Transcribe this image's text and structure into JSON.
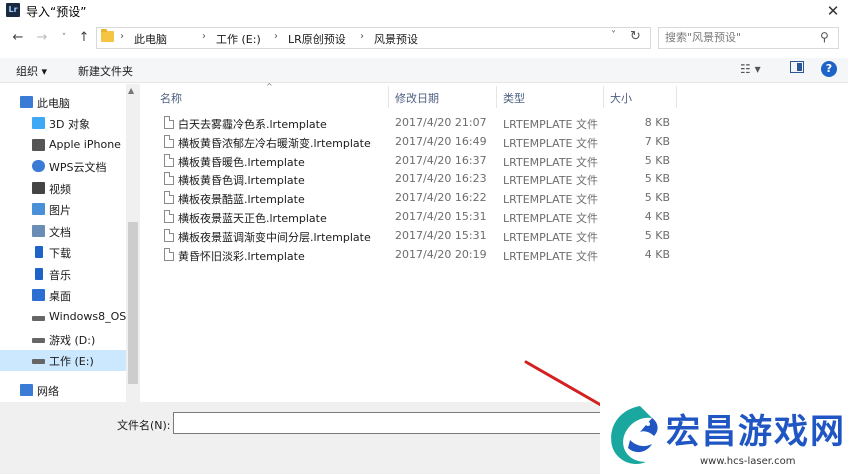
{
  "window": {
    "app_icon_text": "Lr",
    "title": "导入“预设”",
    "close_glyph": "✕"
  },
  "nav": {
    "back_glyph": "←",
    "forward_glyph": "→",
    "recent_glyph": "˅",
    "up_glyph": "↑",
    "breadcrumbs": [
      "此电脑",
      "工作 (E:)",
      "LR原创预设",
      "风景预设"
    ],
    "breadcrumb_sep": "›",
    "dropdown_glyph": "˅",
    "refresh_glyph": "↻",
    "search_placeholder": "搜索\"风景预设\"",
    "search_icon_glyph": "⚲"
  },
  "toolbar": {
    "organize": "组织 ▾",
    "new_folder": "新建文件夹",
    "view_glyph": "☷ ▾",
    "help_glyph": "?"
  },
  "sidebar": {
    "items": [
      {
        "label": "此电脑",
        "icon": "computer-icon",
        "color": "#3a7bd5"
      },
      {
        "label": "3D 对象",
        "icon": "cube-icon",
        "color": "#3fa9f5"
      },
      {
        "label": "Apple iPhone",
        "icon": "phone-icon",
        "color": "#555555"
      },
      {
        "label": "WPS云文档",
        "icon": "cloud-icon",
        "color": "#3a7bd5"
      },
      {
        "label": "视频",
        "icon": "film-icon",
        "color": "#444444"
      },
      {
        "label": "图片",
        "icon": "image-icon",
        "color": "#4a90d9"
      },
      {
        "label": "文档",
        "icon": "document-icon",
        "color": "#6a8db5"
      },
      {
        "label": "下载",
        "icon": "download-icon",
        "color": "#1e64c8"
      },
      {
        "label": "音乐",
        "icon": "music-icon",
        "color": "#1e64c8"
      },
      {
        "label": "桌面",
        "icon": "desktop-icon",
        "color": "#2a6fd1"
      },
      {
        "label": "Windows8_OS",
        "icon": "drive-icon",
        "color": "#666666"
      },
      {
        "label": "游戏 (D:)",
        "icon": "drive-icon",
        "color": "#666666"
      },
      {
        "label": "工作 (E:)",
        "icon": "drive-icon",
        "color": "#666666",
        "selected": true
      },
      {
        "label": "网络",
        "icon": "network-icon",
        "color": "#3a7bd5"
      }
    ]
  },
  "columns": {
    "name": "名称",
    "date": "修改日期",
    "type": "类型",
    "size": "大小",
    "sort_glyph": "^"
  },
  "files": [
    {
      "name": "白天去雾霾冷色系.lrtemplate",
      "date": "2017/4/20 21:07",
      "type": "LRTEMPLATE 文件",
      "size": "8 KB"
    },
    {
      "name": "横板黄昏浓郁左冷右暖渐变.lrtemplate",
      "date": "2017/4/20 16:49",
      "type": "LRTEMPLATE 文件",
      "size": "7 KB"
    },
    {
      "name": "横板黄昏暖色.lrtemplate",
      "date": "2017/4/20 16:37",
      "type": "LRTEMPLATE 文件",
      "size": "5 KB"
    },
    {
      "name": "横板黄昏色调.lrtemplate",
      "date": "2017/4/20 16:23",
      "type": "LRTEMPLATE 文件",
      "size": "5 KB"
    },
    {
      "name": "横板夜景酷蓝.lrtemplate",
      "date": "2017/4/20 16:22",
      "type": "LRTEMPLATE 文件",
      "size": "5 KB"
    },
    {
      "name": "横板夜景蓝天正色.lrtemplate",
      "date": "2017/4/20 15:31",
      "type": "LRTEMPLATE 文件",
      "size": "4 KB"
    },
    {
      "name": "横板夜景蓝调渐变中间分层.lrtemplate",
      "date": "2017/4/20 15:31",
      "type": "LRTEMPLATE 文件",
      "size": "5 KB"
    },
    {
      "name": "黄昏怀旧淡彩.lrtemplate",
      "date": "2017/4/20 20:19",
      "type": "LRTEMPLATE 文件",
      "size": "4 KB"
    }
  ],
  "footer": {
    "filename_label": "文件名(N):",
    "filename_value": ""
  },
  "watermark": {
    "title": "宏昌游戏网",
    "url": "www.hcs-laser.com",
    "title_color": "#1f56c4"
  },
  "colors": {
    "accent": "#1e64c8",
    "selection": "#cce8ff",
    "arrow": "#d32020"
  }
}
